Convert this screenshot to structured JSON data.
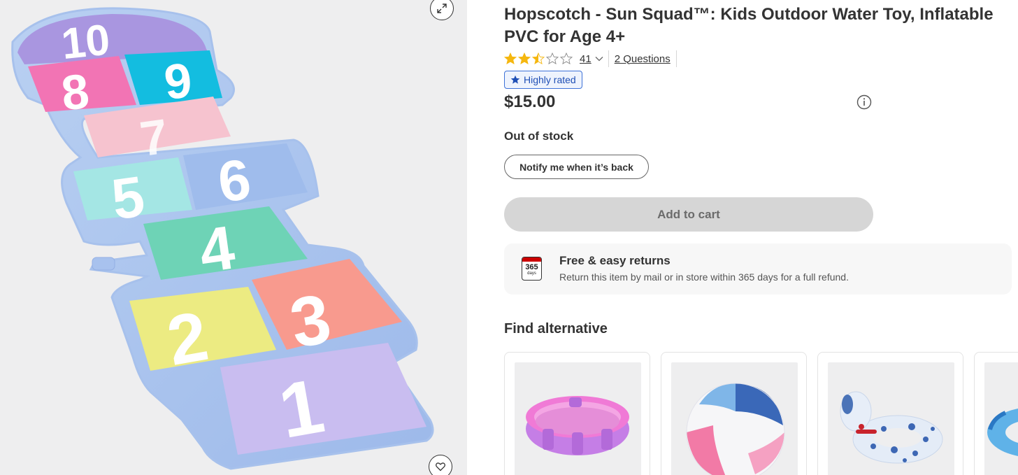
{
  "product": {
    "title": "Hopscotch - Sun Squad™: Kids Outdoor Water Toy, Inflatable PVC for Age 4+",
    "rating_value": 2.5,
    "rating_count": "41",
    "questions_link": "2 Questions",
    "badge": "Highly rated",
    "price": "$15.00",
    "stock_status": "Out of stock",
    "notify_button": "Notify me when it’s back",
    "add_to_cart_button": "Add to cart"
  },
  "returns": {
    "icon_number": "365",
    "icon_unit": "days",
    "title": "Free & easy returns",
    "description": "Return this item by mail or in store within 365 days for a full refund."
  },
  "alternatives": {
    "heading": "Find alternative",
    "items": [
      {
        "image": "kiddie-pool-image"
      },
      {
        "image": "beach-ball-image"
      },
      {
        "image": "dog-float-image"
      },
      {
        "image": "swim-ring-image"
      }
    ]
  },
  "gallery": {
    "numbers": [
      "10",
      "9",
      "8",
      "7",
      "6",
      "5",
      "4",
      "3",
      "2",
      "1"
    ]
  },
  "colors": {
    "star": "#f5b70f",
    "badge_border": "#3e72d8",
    "cart_disabled": "#d6d6d6",
    "calendar_red": "#cc0000"
  }
}
